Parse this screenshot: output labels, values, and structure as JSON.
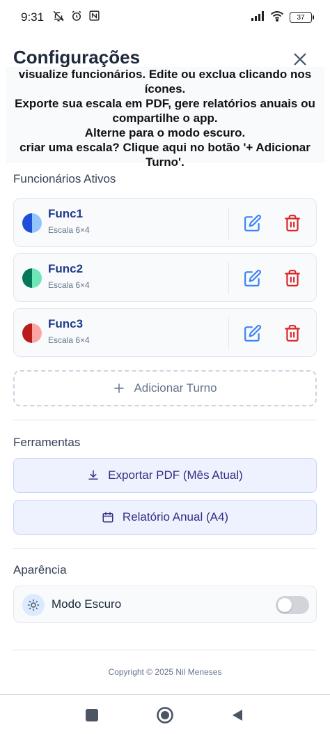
{
  "status_bar": {
    "time": "9:31",
    "battery": "37"
  },
  "header": {
    "title": "Configurações"
  },
  "help_lines": [
    "visualize funcionários. Edite ou exclua clicando nos",
    "ícones.",
    "Exporte sua escala em PDF, gere relatórios anuais ou",
    "compartilhe o app.",
    "Alterne para o modo escuro.",
    "criar uma escala? Clique aqui no botão '+ Adicionar",
    "Turno'."
  ],
  "employees_section": {
    "title": "Funcionários Ativos",
    "items": [
      {
        "name": "Func1",
        "schedule": "Escala 6×4",
        "color_a": "#1d4ed8",
        "color_b": "#93c5fd"
      },
      {
        "name": "Func2",
        "schedule": "Escala 6×4",
        "color_a": "#047857",
        "color_b": "#6ee7b7"
      },
      {
        "name": "Func3",
        "schedule": "Escala 6×4",
        "color_a": "#b91c1c",
        "color_b": "#fca5a5"
      }
    ]
  },
  "add_shift_label": "Adicionar Turno",
  "tools_section": {
    "title": "Ferramentas",
    "export_pdf_label": "Exportar PDF (Mês Atual)",
    "annual_report_label": "Relatório Anual (A4)"
  },
  "appearance_section": {
    "title": "Aparência",
    "dark_mode_label": "Modo Escuro",
    "dark_mode_on": false
  },
  "copyright": "Copyright © 2025 Nil Meneses",
  "colors": {
    "accent_blue": "#3b82f6",
    "delete_red": "#dc2626",
    "name_blue": "#1e3a8a"
  }
}
